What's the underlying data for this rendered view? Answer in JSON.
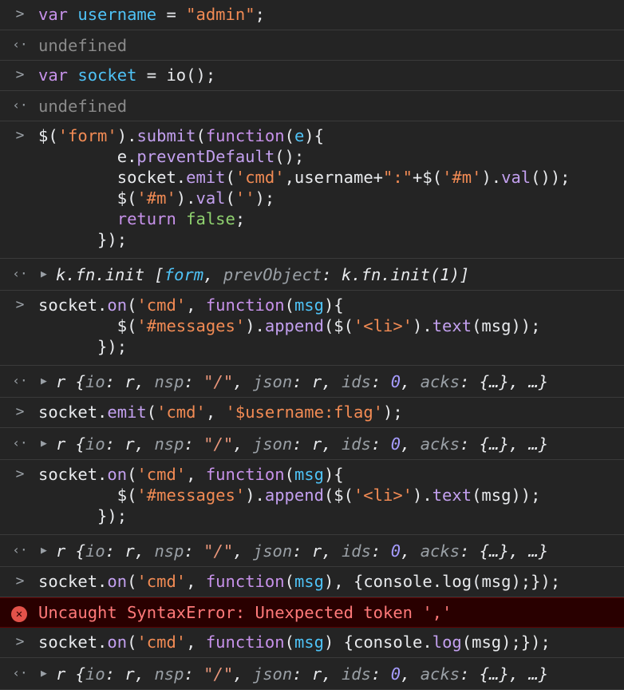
{
  "entries": [
    {
      "kind": "input",
      "lines": [
        [
          {
            "t": "var ",
            "c": "kw"
          },
          {
            "t": "username",
            "c": "var"
          },
          {
            "t": " = ",
            "c": ""
          },
          {
            "t": "\"admin\"",
            "c": "str"
          },
          {
            "t": ";",
            "c": ""
          }
        ]
      ]
    },
    {
      "kind": "output",
      "text": "undefined"
    },
    {
      "kind": "input",
      "lines": [
        [
          {
            "t": "var ",
            "c": "kw"
          },
          {
            "t": "socket",
            "c": "var"
          },
          {
            "t": " = io();",
            "c": ""
          }
        ]
      ]
    },
    {
      "kind": "output",
      "text": "undefined"
    },
    {
      "kind": "input",
      "lines": [
        [
          {
            "t": "$(",
            "c": ""
          },
          {
            "t": "'form'",
            "c": "str"
          },
          {
            "t": ").",
            "c": ""
          },
          {
            "t": "submit",
            "c": "fn"
          },
          {
            "t": "(",
            "c": ""
          },
          {
            "t": "function",
            "c": "kw"
          },
          {
            "t": "(",
            "c": ""
          },
          {
            "t": "e",
            "c": "var"
          },
          {
            "t": "){",
            "c": ""
          }
        ],
        [
          {
            "t": "        e.",
            "c": ""
          },
          {
            "t": "preventDefault",
            "c": "fn"
          },
          {
            "t": "();",
            "c": ""
          }
        ],
        [
          {
            "t": "        socket.",
            "c": ""
          },
          {
            "t": "emit",
            "c": "fn"
          },
          {
            "t": "(",
            "c": ""
          },
          {
            "t": "'cmd'",
            "c": "str"
          },
          {
            "t": ",username+",
            "c": ""
          },
          {
            "t": "\":\"",
            "c": "str"
          },
          {
            "t": "+$(",
            "c": ""
          },
          {
            "t": "'#m'",
            "c": "str"
          },
          {
            "t": ").",
            "c": ""
          },
          {
            "t": "val",
            "c": "fn"
          },
          {
            "t": "());",
            "c": ""
          }
        ],
        [
          {
            "t": "        $(",
            "c": ""
          },
          {
            "t": "'#m'",
            "c": "str"
          },
          {
            "t": ").",
            "c": ""
          },
          {
            "t": "val",
            "c": "fn"
          },
          {
            "t": "(",
            "c": ""
          },
          {
            "t": "''",
            "c": "str"
          },
          {
            "t": ");",
            "c": ""
          }
        ],
        [
          {
            "t": "        ",
            "c": ""
          },
          {
            "t": "return",
            "c": "kw"
          },
          {
            "t": " ",
            "c": ""
          },
          {
            "t": "false",
            "c": "bool"
          },
          {
            "t": ";",
            "c": ""
          }
        ],
        [
          {
            "t": "      });",
            "c": ""
          }
        ]
      ]
    },
    {
      "kind": "result",
      "parts": [
        {
          "t": "k.fn.init ",
          "c": "it"
        },
        {
          "t": "[",
          "c": "it"
        },
        {
          "t": "form",
          "c": "it objname"
        },
        {
          "t": ", ",
          "c": "it"
        },
        {
          "t": "prevObject",
          "c": "it prop"
        },
        {
          "t": ": k.fn.init(1)]",
          "c": "it"
        }
      ]
    },
    {
      "kind": "input",
      "lines": [
        [
          {
            "t": "socket.",
            "c": ""
          },
          {
            "t": "on",
            "c": "fn"
          },
          {
            "t": "(",
            "c": ""
          },
          {
            "t": "'cmd'",
            "c": "str"
          },
          {
            "t": ", ",
            "c": ""
          },
          {
            "t": "function",
            "c": "kw"
          },
          {
            "t": "(",
            "c": ""
          },
          {
            "t": "msg",
            "c": "var"
          },
          {
            "t": "){",
            "c": ""
          }
        ],
        [
          {
            "t": "        $(",
            "c": ""
          },
          {
            "t": "'#messages'",
            "c": "str"
          },
          {
            "t": ").",
            "c": ""
          },
          {
            "t": "append",
            "c": "fn"
          },
          {
            "t": "($(",
            "c": ""
          },
          {
            "t": "'<li>'",
            "c": "str"
          },
          {
            "t": ").",
            "c": ""
          },
          {
            "t": "text",
            "c": "fn"
          },
          {
            "t": "(msg));",
            "c": ""
          }
        ],
        [
          {
            "t": "      });",
            "c": ""
          }
        ]
      ]
    },
    {
      "kind": "result",
      "parts": [
        {
          "t": "r {",
          "c": "it"
        },
        {
          "t": "io",
          "c": "it prop"
        },
        {
          "t": ": r, ",
          "c": "it"
        },
        {
          "t": "nsp",
          "c": "it prop"
        },
        {
          "t": ": ",
          "c": "it"
        },
        {
          "t": "\"/\"",
          "c": "it strd"
        },
        {
          "t": ", ",
          "c": "it"
        },
        {
          "t": "json",
          "c": "it prop"
        },
        {
          "t": ": r, ",
          "c": "it"
        },
        {
          "t": "ids",
          "c": "it prop"
        },
        {
          "t": ": ",
          "c": "it"
        },
        {
          "t": "0",
          "c": "it num"
        },
        {
          "t": ", ",
          "c": "it"
        },
        {
          "t": "acks",
          "c": "it prop"
        },
        {
          "t": ": {…}, …}",
          "c": "it"
        }
      ]
    },
    {
      "kind": "input",
      "lines": [
        [
          {
            "t": "socket.",
            "c": ""
          },
          {
            "t": "emit",
            "c": "fn"
          },
          {
            "t": "(",
            "c": ""
          },
          {
            "t": "'cmd'",
            "c": "str"
          },
          {
            "t": ", ",
            "c": ""
          },
          {
            "t": "'$username:flag'",
            "c": "str"
          },
          {
            "t": ");",
            "c": ""
          }
        ]
      ]
    },
    {
      "kind": "result",
      "parts": [
        {
          "t": "r {",
          "c": "it"
        },
        {
          "t": "io",
          "c": "it prop"
        },
        {
          "t": ": r, ",
          "c": "it"
        },
        {
          "t": "nsp",
          "c": "it prop"
        },
        {
          "t": ": ",
          "c": "it"
        },
        {
          "t": "\"/\"",
          "c": "it strd"
        },
        {
          "t": ", ",
          "c": "it"
        },
        {
          "t": "json",
          "c": "it prop"
        },
        {
          "t": ": r, ",
          "c": "it"
        },
        {
          "t": "ids",
          "c": "it prop"
        },
        {
          "t": ": ",
          "c": "it"
        },
        {
          "t": "0",
          "c": "it num"
        },
        {
          "t": ", ",
          "c": "it"
        },
        {
          "t": "acks",
          "c": "it prop"
        },
        {
          "t": ": {…}, …}",
          "c": "it"
        }
      ]
    },
    {
      "kind": "input",
      "lines": [
        [
          {
            "t": "socket.",
            "c": ""
          },
          {
            "t": "on",
            "c": "fn"
          },
          {
            "t": "(",
            "c": ""
          },
          {
            "t": "'cmd'",
            "c": "str"
          },
          {
            "t": ", ",
            "c": ""
          },
          {
            "t": "function",
            "c": "kw"
          },
          {
            "t": "(",
            "c": ""
          },
          {
            "t": "msg",
            "c": "var"
          },
          {
            "t": "){",
            "c": ""
          }
        ],
        [
          {
            "t": "        $(",
            "c": ""
          },
          {
            "t": "'#messages'",
            "c": "str"
          },
          {
            "t": ").",
            "c": ""
          },
          {
            "t": "append",
            "c": "fn"
          },
          {
            "t": "($(",
            "c": ""
          },
          {
            "t": "'<li>'",
            "c": "str"
          },
          {
            "t": ").",
            "c": ""
          },
          {
            "t": "text",
            "c": "fn"
          },
          {
            "t": "(msg));",
            "c": ""
          }
        ],
        [
          {
            "t": "      });",
            "c": ""
          }
        ]
      ]
    },
    {
      "kind": "result",
      "parts": [
        {
          "t": "r {",
          "c": "it"
        },
        {
          "t": "io",
          "c": "it prop"
        },
        {
          "t": ": r, ",
          "c": "it"
        },
        {
          "t": "nsp",
          "c": "it prop"
        },
        {
          "t": ": ",
          "c": "it"
        },
        {
          "t": "\"/\"",
          "c": "it strd"
        },
        {
          "t": ", ",
          "c": "it"
        },
        {
          "t": "json",
          "c": "it prop"
        },
        {
          "t": ": r, ",
          "c": "it"
        },
        {
          "t": "ids",
          "c": "it prop"
        },
        {
          "t": ": ",
          "c": "it"
        },
        {
          "t": "0",
          "c": "it num"
        },
        {
          "t": ", ",
          "c": "it"
        },
        {
          "t": "acks",
          "c": "it prop"
        },
        {
          "t": ": {…}, …}",
          "c": "it"
        }
      ]
    },
    {
      "kind": "input",
      "lines": [
        [
          {
            "t": "socket.",
            "c": ""
          },
          {
            "t": "on",
            "c": "fn"
          },
          {
            "t": "(",
            "c": ""
          },
          {
            "t": "'cmd'",
            "c": "str"
          },
          {
            "t": ", ",
            "c": ""
          },
          {
            "t": "function",
            "c": "kw"
          },
          {
            "t": "(",
            "c": ""
          },
          {
            "t": "msg",
            "c": "var"
          },
          {
            "t": "), {console.log(msg);});",
            "c": ""
          }
        ]
      ]
    },
    {
      "kind": "error",
      "text": "Uncaught SyntaxError: Unexpected token ','"
    },
    {
      "kind": "input",
      "lines": [
        [
          {
            "t": "socket.",
            "c": ""
          },
          {
            "t": "on",
            "c": "fn"
          },
          {
            "t": "(",
            "c": ""
          },
          {
            "t": "'cmd'",
            "c": "str"
          },
          {
            "t": ", ",
            "c": ""
          },
          {
            "t": "function",
            "c": "kw"
          },
          {
            "t": "(",
            "c": ""
          },
          {
            "t": "msg",
            "c": "var"
          },
          {
            "t": ") {console.",
            "c": ""
          },
          {
            "t": "log",
            "c": "fn"
          },
          {
            "t": "(msg);});",
            "c": ""
          }
        ]
      ]
    },
    {
      "kind": "result",
      "parts": [
        {
          "t": "r {",
          "c": "it"
        },
        {
          "t": "io",
          "c": "it prop"
        },
        {
          "t": ": r, ",
          "c": "it"
        },
        {
          "t": "nsp",
          "c": "it prop"
        },
        {
          "t": ": ",
          "c": "it"
        },
        {
          "t": "\"/\"",
          "c": "it strd"
        },
        {
          "t": ", ",
          "c": "it"
        },
        {
          "t": "json",
          "c": "it prop"
        },
        {
          "t": ": r, ",
          "c": "it"
        },
        {
          "t": "ids",
          "c": "it prop"
        },
        {
          "t": ": ",
          "c": "it"
        },
        {
          "t": "0",
          "c": "it num"
        },
        {
          "t": ", ",
          "c": "it"
        },
        {
          "t": "acks",
          "c": "it prop"
        },
        {
          "t": ": {…}, …}",
          "c": "it"
        }
      ]
    }
  ],
  "icons": {
    "input_prompt": "chevron-right-icon",
    "output_marker": "return-arrow-icon",
    "expand": "expand-triangle-icon",
    "error": "error-circle-icon"
  },
  "colors": {
    "background": "#242424",
    "keyword": "#c792ea",
    "variable": "#4fc3f7",
    "string": "#f28b54",
    "error_text": "#ff7a7a",
    "error_bg": "#290000"
  }
}
